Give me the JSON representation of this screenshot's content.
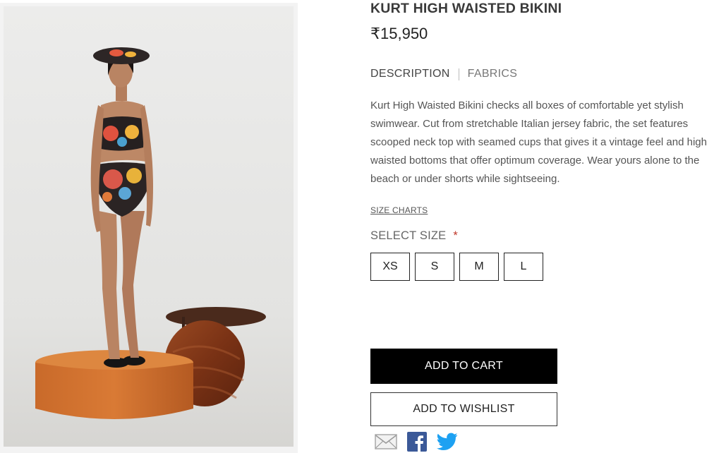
{
  "product": {
    "title": "KURT HIGH WAISTED BIKINI",
    "price": "₹15,950",
    "image_alt": "Model wearing printed high waisted bikini standing on an orange pedestal"
  },
  "tabs": {
    "description": "DESCRIPTION",
    "fabrics": "FABRICS"
  },
  "description": "Kurt High Waisted Bikini checks all boxes of comfortable yet stylish swimwear. Cut from stretchable Italian jersey fabric, the set features scooped neck top with seamed cups that gives it a vintage feel and high waisted bottoms that offer optimum coverage. Wear yours alone to the beach or under shorts while sightseeing.",
  "size_chart_link": "SIZE CHARTS",
  "select_size": {
    "label": "SELECT SIZE",
    "required_marker": "*",
    "options": [
      "XS",
      "S",
      "M",
      "L"
    ]
  },
  "actions": {
    "add_to_cart": "ADD TO CART",
    "add_to_wishlist": "ADD TO WISHLIST"
  },
  "share_icons": [
    "mail-icon",
    "facebook-icon",
    "twitter-icon"
  ],
  "colors": {
    "cart_button": "#000000",
    "required": "#c0392b",
    "facebook": "#3b5998",
    "twitter": "#1da1f2"
  }
}
